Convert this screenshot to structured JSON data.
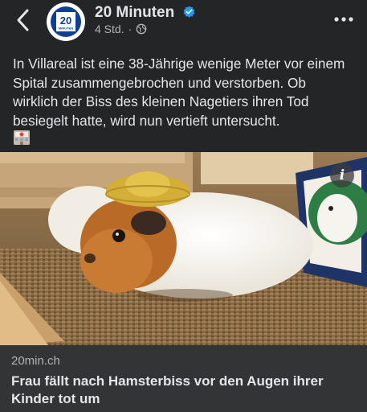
{
  "header": {
    "page_name": "20 Minuten",
    "avatar_text": "20",
    "avatar_subtext": "MINUTEN",
    "timestamp": "4 Std.",
    "separator": "·",
    "icons": [
      "back-chevron-icon",
      "verified-badge-icon",
      "globe-icon",
      "more-options-icon"
    ]
  },
  "post": {
    "text": "In Villareal ist eine 38-Jährige wenige Meter vor einem Spital zusammengebrochen und verstorben. Ob wirklich der Biss des kleinen Nagetiers ihren Tod besiegelt hatte, wird nun vertieft untersucht.",
    "emoji": "hospital-emoji"
  },
  "link_preview": {
    "domain": "20min.ch",
    "headline": "Frau fällt nach Hamsterbiss vor den Augen ihrer Kinder tot um",
    "info_label": "i"
  },
  "colors": {
    "background": "#242526",
    "card_background": "#323436",
    "text_primary": "#e4e6eb",
    "text_secondary": "#b0b3b8",
    "verified_blue": "#1d9bf0",
    "brand_blue": "#0d3f96"
  }
}
